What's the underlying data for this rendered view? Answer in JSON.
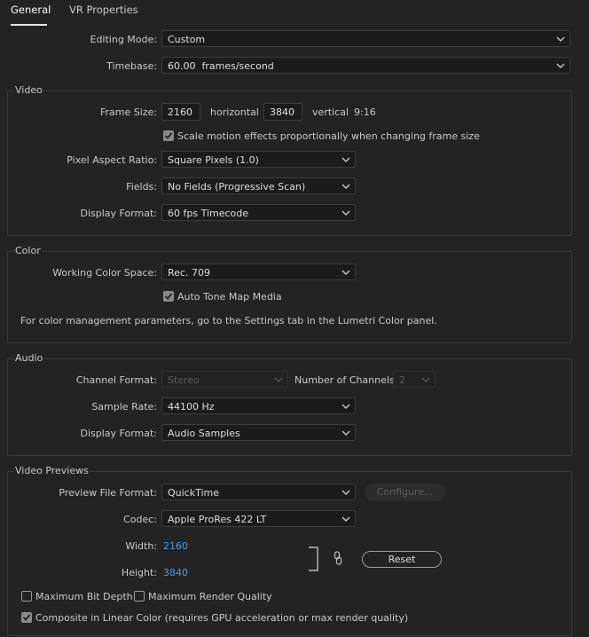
{
  "tabs": [
    {
      "label": "General",
      "active": true
    },
    {
      "label": "VR Properties",
      "active": false
    }
  ],
  "general": {
    "editing_mode_label": "Editing Mode:",
    "editing_mode_value": "Custom",
    "timebase_label": "Timebase:",
    "timebase_value": "60.00  frames/second"
  },
  "video": {
    "title": "Video",
    "frame_size_label": "Frame Size:",
    "frame_width": "2160",
    "horizontal_label": "horizontal",
    "frame_height": "3840",
    "vertical_label": "vertical",
    "aspect": "9:16",
    "scale_checkbox_label": "Scale motion effects proportionally when changing frame size",
    "scale_checked": true,
    "pixel_aspect_label": "Pixel Aspect Ratio:",
    "pixel_aspect_value": "Square Pixels (1.0)",
    "fields_label": "Fields:",
    "fields_value": "No Fields (Progressive Scan)",
    "display_format_label": "Display Format:",
    "display_format_value": "60 fps Timecode"
  },
  "color": {
    "title": "Color",
    "working_space_label": "Working Color Space:",
    "working_space_value": "Rec. 709",
    "auto_tone_label": "Auto Tone Map Media",
    "auto_tone_checked": true,
    "info_text": "For color management parameters, go to the Settings tab in the Lumetri Color panel."
  },
  "audio": {
    "title": "Audio",
    "channel_format_label": "Channel Format:",
    "channel_format_value": "Stereo",
    "num_channels_label": "Number of Channels:",
    "num_channels_value": "2",
    "sample_rate_label": "Sample Rate:",
    "sample_rate_value": "44100 Hz",
    "display_format_label": "Display Format:",
    "display_format_value": "Audio Samples"
  },
  "previews": {
    "title": "Video Previews",
    "file_format_label": "Preview File Format:",
    "file_format_value": "QuickTime",
    "configure_label": "Configure...",
    "codec_label": "Codec:",
    "codec_value": "Apple ProRes 422 LT",
    "width_label": "Width:",
    "width_value": "2160",
    "height_label": "Height:",
    "height_value": "3840",
    "reset_label": "Reset",
    "max_bit_depth_label": "Maximum Bit Depth",
    "max_bit_depth_checked": false,
    "max_render_quality_label": "Maximum Render Quality",
    "max_render_quality_checked": false,
    "linear_color_label": "Composite in Linear Color (requires GPU acceleration or max render quality)",
    "linear_color_checked": true
  },
  "colors": {
    "background": "#232323",
    "accent_blue": "#4a9fde",
    "field_bg": "#1b1b1b",
    "checkbox_on": "#8a8a8a"
  },
  "icons": [
    "chevron-down-icon",
    "checkmark-icon",
    "link-icon",
    "bracket-icon"
  ]
}
